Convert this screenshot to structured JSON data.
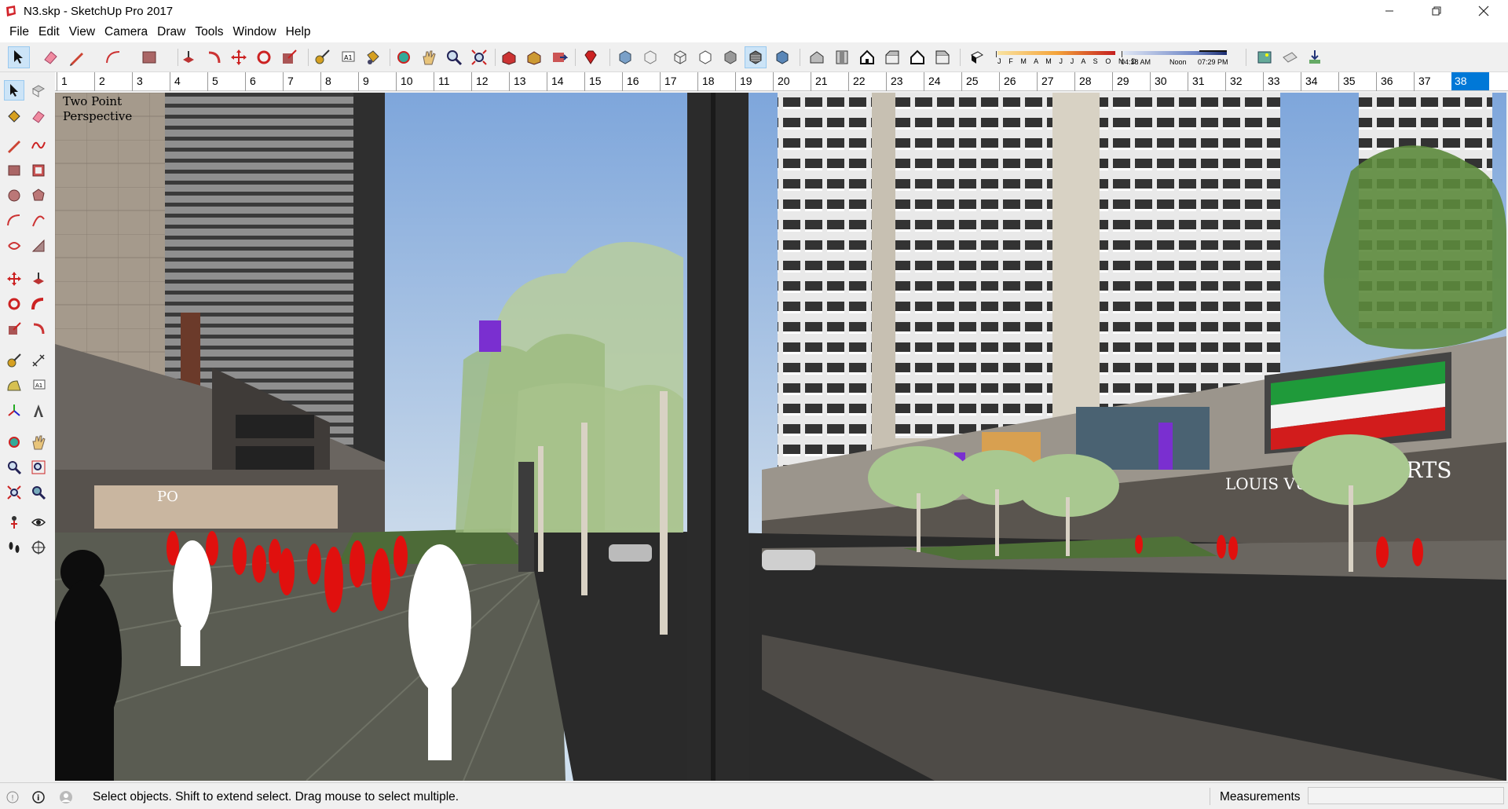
{
  "window": {
    "title": "N3.skp - SketchUp Pro 2017",
    "minimize_icon": "minimize-icon",
    "maximize_icon": "restore-icon",
    "close_icon": "close-icon"
  },
  "menu": {
    "items": [
      "File",
      "Edit",
      "View",
      "Camera",
      "Draw",
      "Tools",
      "Window",
      "Help"
    ]
  },
  "shadow": {
    "months": "J F M A M J J A S O N D",
    "time_start": "04:38 AM",
    "time_mid": "Noon",
    "time_end": "07:29 PM"
  },
  "ruler": {
    "numbers": [
      "1",
      "2",
      "3",
      "4",
      "5",
      "6",
      "7",
      "8",
      "9",
      "10",
      "11",
      "12",
      "13",
      "14",
      "15",
      "16",
      "17",
      "18",
      "19",
      "20",
      "21",
      "22",
      "23",
      "24",
      "25",
      "26",
      "27",
      "28",
      "29",
      "30",
      "31",
      "32",
      "33",
      "34",
      "35",
      "36",
      "37"
    ],
    "active": "38"
  },
  "viewport": {
    "camera_label_line1": "Two Point",
    "camera_label_line2": "Perspective"
  },
  "status": {
    "hint": "Select objects. Shift to extend select. Drag mouse to select multiple.",
    "measurements_label": "Measurements",
    "measurements_value": ""
  },
  "colors": {
    "accent": "#0078d7",
    "people": "#e0100e",
    "sky": "#8fb4e0",
    "road": "#2a2a2a"
  }
}
